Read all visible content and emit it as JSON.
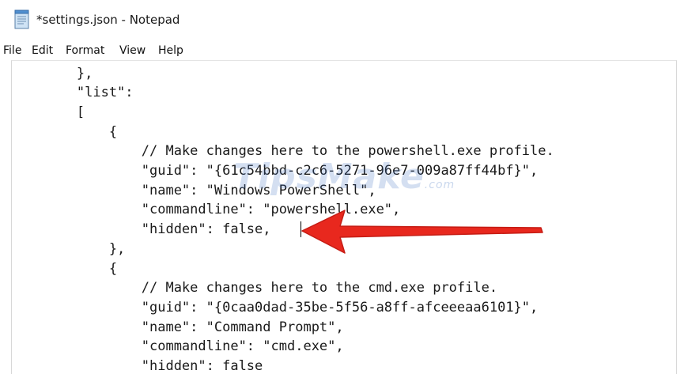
{
  "window": {
    "title": "*settings.json - Notepad",
    "app_icon": "notepad-icon"
  },
  "menu": [
    {
      "label": "File"
    },
    {
      "label": "Edit"
    },
    {
      "label": "Format"
    },
    {
      "label": "View"
    },
    {
      "label": "Help"
    }
  ],
  "editor": {
    "lines": [
      "        },",
      "        \"list\":",
      "        [",
      "            {",
      "                // Make changes here to the powershell.exe profile.",
      "                \"guid\": \"{61c54bbd-c2c6-5271-96e7-009a87ff44bf}\",",
      "                \"name\": \"Windows PowerShell\",",
      "                \"commandline\": \"powershell.exe\",",
      "                \"hidden\": false,",
      "            },",
      "            {",
      "                // Make changes here to the cmd.exe profile.",
      "                \"guid\": \"{0caa0dad-35be-5f56-a8ff-afceeeaa6101}\",",
      "                \"name\": \"Command Prompt\",",
      "                \"commandline\": \"cmd.exe\",",
      "                \"hidden\": false"
    ],
    "caret_line": 9
  },
  "watermark": {
    "text": "TipsMake",
    "suffix": ".com"
  },
  "annotation": {
    "icon": "red-arrow-icon",
    "color": "#e8281e"
  }
}
